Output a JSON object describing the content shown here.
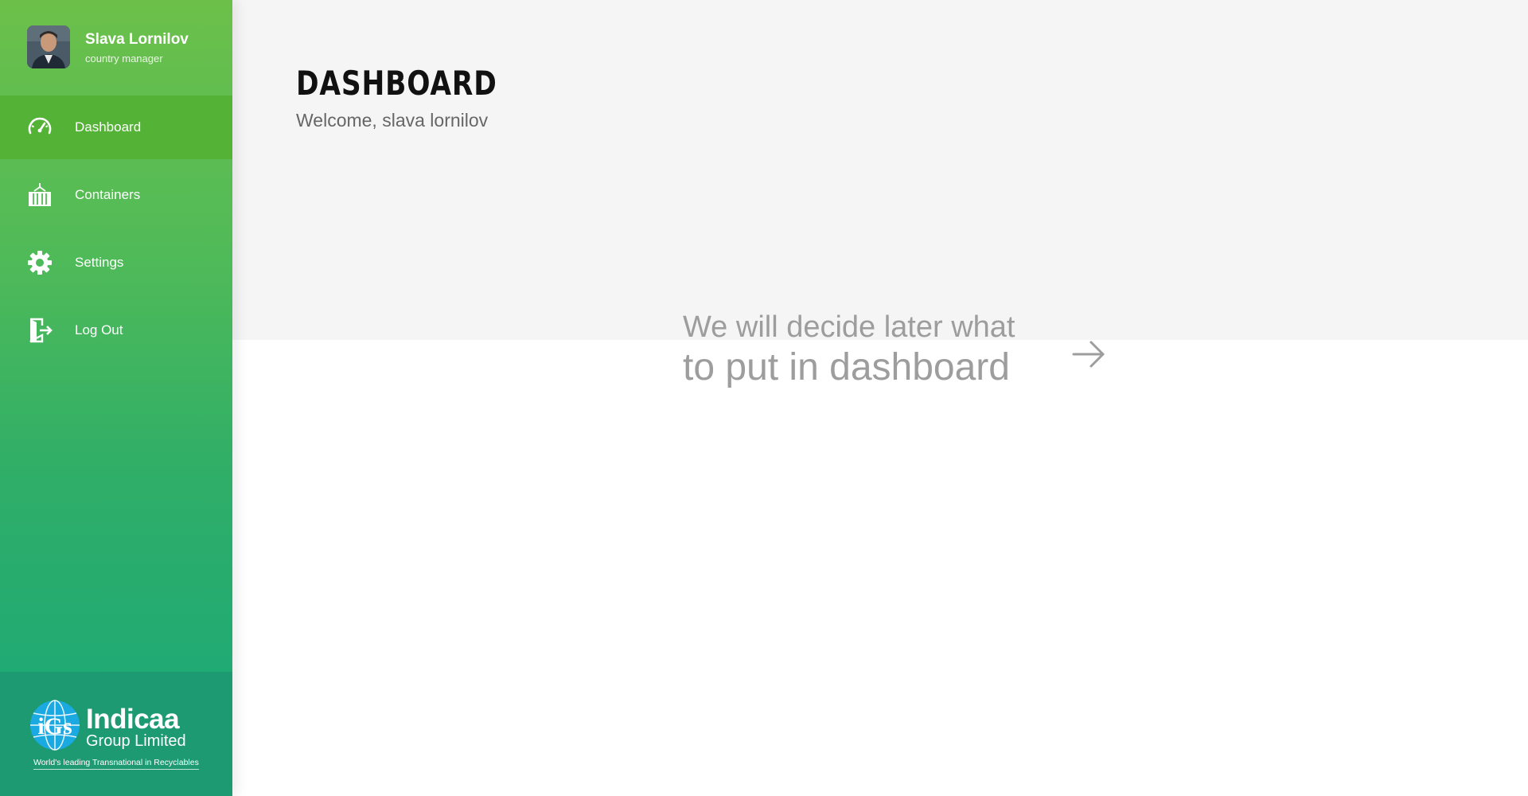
{
  "user": {
    "name": "Slava Lornilov",
    "role": "country manager"
  },
  "nav": {
    "items": [
      {
        "label": "Dashboard",
        "icon": "speedometer-icon",
        "active": true
      },
      {
        "label": "Containers",
        "icon": "container-icon",
        "active": false
      },
      {
        "label": "Settings",
        "icon": "gear-icon",
        "active": false
      },
      {
        "label": "Log Out",
        "icon": "logout-icon",
        "active": false
      }
    ]
  },
  "brand": {
    "name": "Indicaa",
    "sub": "Group Limited",
    "tagline": "World's leading Transnational in Recyclables",
    "logo_letters": "iGs"
  },
  "page": {
    "title": "DASHBOARD",
    "welcome": "Welcome, slava lornilov"
  },
  "placeholder": {
    "line1": "We will decide later what",
    "line2": "to put in dashboard"
  },
  "colors": {
    "sidebar_top": "#6cc04a",
    "sidebar_bottom": "#17a87b",
    "active_item": "#54b236",
    "brand_bg": "#1d9a72",
    "header_bg": "#f5f5f5",
    "muted_text": "#9d9d9d"
  }
}
